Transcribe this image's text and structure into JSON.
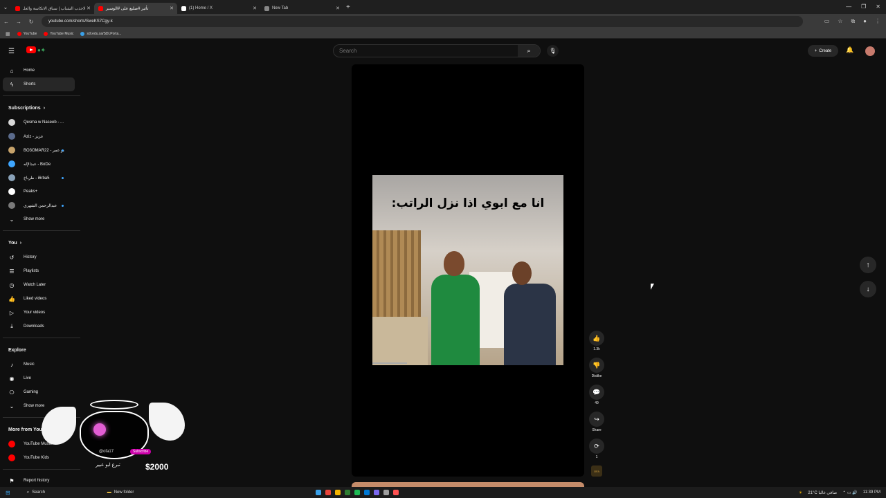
{
  "browser": {
    "tabs": [
      {
        "label": "لاجذب الشباب | سباق الانكاسة والعلـ",
        "active": false,
        "favicon_color": "#ff0000"
      },
      {
        "label": "تأثير #صليع على #الوسير",
        "active": true,
        "favicon_color": "#ff0000"
      },
      {
        "label": "(1) Home / X",
        "active": false,
        "favicon_color": "#ffffff"
      },
      {
        "label": "New Tab",
        "active": false,
        "favicon_color": "#888888"
      }
    ],
    "new_tab_label": "+",
    "url": "youtube.com/shorts/SweKS7Cgy-k",
    "bookmarks": [
      {
        "label": "YouTube",
        "color": "#ff0000"
      },
      {
        "label": "YouTube Music",
        "color": "#ff0000"
      },
      {
        "label": "sdl.edu.sa/SDLPorta...",
        "color": "#3aa0e8"
      }
    ]
  },
  "youtube": {
    "search_placeholder": "Search",
    "create_label": "Create",
    "sidebar": {
      "main": [
        {
          "label": "Home",
          "icon": "home-icon",
          "glyph": "⌂"
        },
        {
          "label": "Shorts",
          "icon": "shorts-icon",
          "glyph": "ϟ",
          "active": true
        }
      ],
      "subscriptions_title": "Subscriptions",
      "subscriptions": [
        {
          "label": "Qesma w Naseeb - ...",
          "color": "#d9d9d9",
          "dot": false
        },
        {
          "label": "Aziz - عزيز",
          "color": "#5b6b8c",
          "dot": false
        },
        {
          "label": "BO3OMAR22 - بو عمر",
          "color": "#c7a36b",
          "dot": true
        },
        {
          "label": "عبدالإله - BoDe",
          "color": "#3ea6ff",
          "dot": false
        },
        {
          "label": "طرباخ - i6rba5",
          "color": "#8aa2b8",
          "dot": true
        },
        {
          "label": "Peaks+",
          "color": "#ffffff",
          "dot": false
        },
        {
          "label": "عبدالرحمن الشهري",
          "color": "#7a7a7a",
          "dot": true
        }
      ],
      "show_more": "Show more",
      "you_title": "You",
      "you": [
        {
          "label": "History",
          "icon": "history-icon",
          "glyph": "↺"
        },
        {
          "label": "Playlists",
          "icon": "playlists-icon",
          "glyph": "☰"
        },
        {
          "label": "Watch Later",
          "icon": "watch-later-icon",
          "glyph": "◷"
        },
        {
          "label": "Liked videos",
          "icon": "like-icon",
          "glyph": "👍"
        },
        {
          "label": "Your videos",
          "icon": "your-videos-icon",
          "glyph": "▷"
        },
        {
          "label": "Downloads",
          "icon": "download-icon",
          "glyph": "⤓"
        }
      ],
      "explore_title": "Explore",
      "explore": [
        {
          "label": "Music",
          "icon": "music-icon",
          "glyph": "♪"
        },
        {
          "label": "Live",
          "icon": "live-icon",
          "glyph": "◉"
        },
        {
          "label": "Gaming",
          "icon": "gaming-icon",
          "glyph": "⎔"
        }
      ],
      "explore_more": "Show more",
      "more_title": "More from YouTube",
      "more": [
        {
          "label": "YouTube Music",
          "color": "#ff0000"
        },
        {
          "label": "YouTube Kids",
          "color": "#ff0000"
        }
      ],
      "report": "Report history"
    },
    "short": {
      "overlay_text": "انا مع ابوي اذا نزل الراتب:",
      "likes": "1.3k",
      "dislike_label": "Dislike",
      "comments": "49",
      "share_label": "Share",
      "remix_count": "1",
      "channel_badge": "OFA"
    }
  },
  "sticker": {
    "user": "@ofa17",
    "subscribe": "Subscribe",
    "name": "تبرع ابو عبير",
    "amount": "$2000"
  },
  "taskbar": {
    "search": "Search",
    "folder": "New folder",
    "weather": "21°C صافي غالبا",
    "time": "11:39 PM",
    "app_colors": [
      "#3aa0e8",
      "#e8453c",
      "#f4b400",
      "#2e7d32",
      "#1db954",
      "#0078d4",
      "#7b68ee",
      "#9e9e9e",
      "#ff5252"
    ]
  }
}
